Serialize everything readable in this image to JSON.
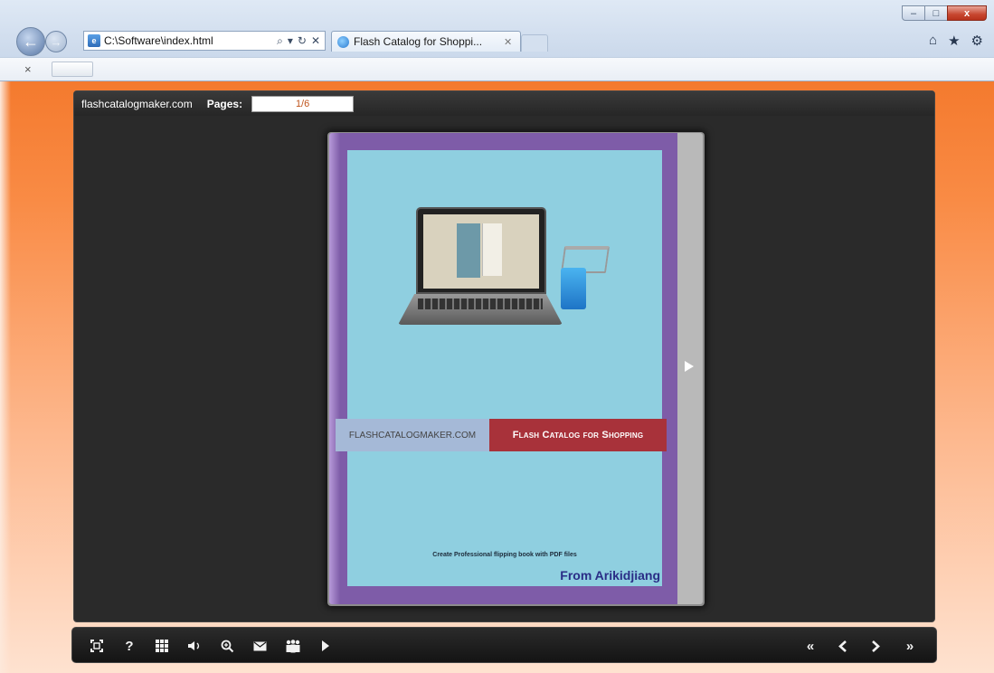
{
  "browser": {
    "address_url": "C:\\Software\\index.html",
    "tab_title": "Flash Catalog for Shoppi...",
    "window_buttons": {
      "minimize": "–",
      "maximize": "□",
      "close": "x"
    },
    "nav": {
      "back": "back-arrow-icon",
      "forward": "forward-arrow-icon"
    },
    "address_icons": {
      "search": "⌕",
      "dropdown": "▾",
      "refresh": "↻",
      "stop": "✕"
    },
    "right_icons": {
      "home": "⌂",
      "favorites": "★",
      "settings": "⚙"
    },
    "command_bar": {
      "close_label": "×"
    }
  },
  "flipbook": {
    "site_name": "flashcatalogmaker.com",
    "pages_label": "Pages:",
    "page_indicator": "1/6",
    "cover": {
      "brand_site": "FLASHCATALOGMAKER.COM",
      "title": "Flash Catalog for Shopping",
      "tagline": "Create Professional flipping book with PDF files",
      "author": "From Arikidjiang"
    },
    "toolbar_left": [
      "fullscreen-icon",
      "help-icon",
      "thumbnails-icon",
      "sound-icon",
      "zoom-in-icon",
      "email-icon",
      "share-icon",
      "autoplay-icon"
    ],
    "toolbar_right": [
      "first-page-icon",
      "previous-page-icon",
      "next-page-icon",
      "last-page-icon"
    ],
    "colors": {
      "page_background": "#f98b45",
      "viewer_background": "#2a2a2a",
      "cover_border": "#7e5ca8",
      "cover_fill": "#8fcfe0",
      "title_banner": "#a8323a",
      "author_text": "#2a2d86"
    }
  }
}
